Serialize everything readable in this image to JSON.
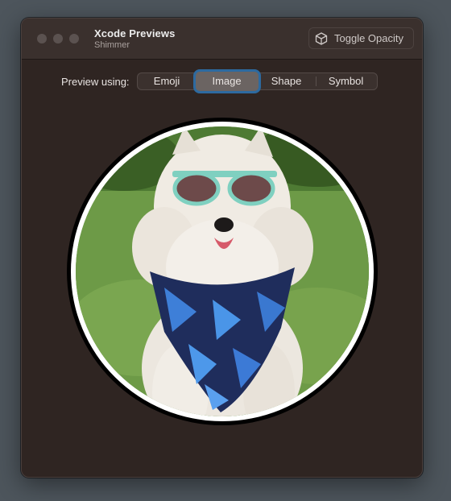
{
  "window": {
    "title": "Xcode Previews",
    "subtitle": "Shimmer",
    "toggle_button": {
      "label": "Toggle Opacity",
      "icon": "cube-icon"
    }
  },
  "preview_picker": {
    "label": "Preview using:",
    "options": [
      "Emoji",
      "Image",
      "Shape",
      "Symbol"
    ],
    "selected": "Image"
  },
  "preview": {
    "type": "image",
    "subject": "dog-photo",
    "shape": "circle",
    "border_colors": [
      "#000000",
      "#ffffff"
    ]
  }
}
